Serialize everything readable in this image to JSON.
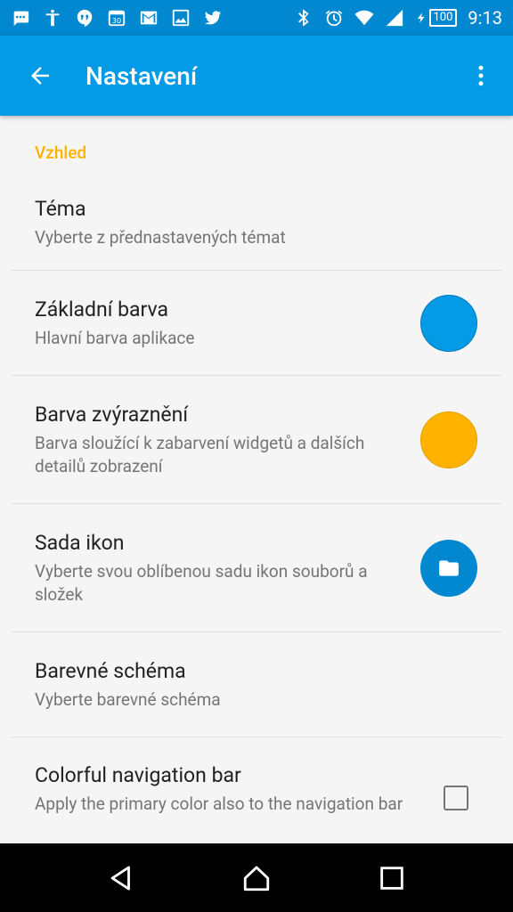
{
  "status_bar": {
    "time": "9:13",
    "battery": "100",
    "date_icon_text": "30",
    "icons_left": [
      "messaging-icon",
      "accessibility-icon",
      "hangouts-icon",
      "calendar-icon",
      "gmail-icon",
      "gallery-icon",
      "twitter-icon"
    ],
    "icons_right": [
      "bluetooth-icon",
      "alarm-icon",
      "wifi-icon",
      "signal-icon",
      "charging-icon"
    ]
  },
  "app_bar": {
    "title": "Nastavení",
    "back_icon": "arrow-back-icon",
    "overflow_icon": "more-vert-icon"
  },
  "settings": {
    "category": "Vzhled",
    "items": [
      {
        "title": "Téma",
        "summary": "Vyberte z přednastavených témat"
      },
      {
        "title": "Základní barva",
        "summary": "Hlavní barva aplikace",
        "swatch_color": "#039be5"
      },
      {
        "title": "Barva zvýraznění",
        "summary": "Barva sloužící k zabarvení widgetů a dalších detailů zobrazení",
        "swatch_color": "#ffb300"
      },
      {
        "title": "Sada ikon",
        "summary": "Vyberte svou oblíbenou sadu ikon souborů a složek",
        "swatch_color": "#0288d1",
        "icon": "folder-icon"
      },
      {
        "title": "Barevné schéma",
        "summary": "Vyberte barevné schéma"
      },
      {
        "title": "Colorful navigation bar",
        "summary": "Apply the primary color also to the navigation bar",
        "checked": false
      }
    ]
  },
  "nav_bar": {
    "back_icon": "nav-back-icon",
    "home_icon": "nav-home-icon",
    "recents_icon": "nav-recents-icon"
  },
  "colors": {
    "status_bar": "#0288d1",
    "app_bar": "#039be5",
    "accent": "#ffb300",
    "background": "#f5f5f5"
  }
}
